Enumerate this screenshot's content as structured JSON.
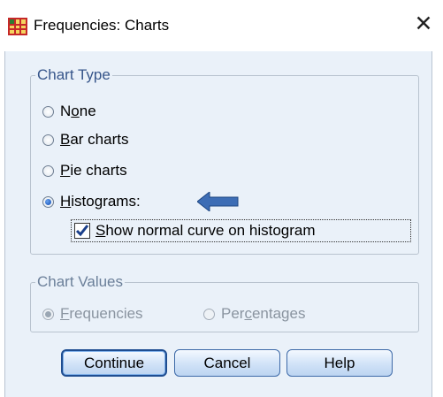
{
  "window": {
    "title": "Frequencies: Charts",
    "close_glyph": "✕"
  },
  "chart_type": {
    "legend": "Chart Type",
    "options": [
      {
        "label": "None",
        "mnemonic_index": 1,
        "checked": false
      },
      {
        "label": "Bar charts",
        "mnemonic_index": 0,
        "checked": false
      },
      {
        "label": "Pie charts",
        "mnemonic_index": 0,
        "checked": false
      },
      {
        "label": "Histograms:",
        "mnemonic_index": 0,
        "checked": true
      }
    ],
    "show_normal_curve": {
      "label": "Show normal curve on histogram",
      "checked": true
    }
  },
  "chart_values": {
    "legend": "Chart Values",
    "options": [
      {
        "label": "Frequencies",
        "checked": true,
        "enabled": false
      },
      {
        "label": "Percentages",
        "checked": false,
        "enabled": false
      }
    ]
  },
  "buttons": {
    "continue": "Continue",
    "cancel": "Cancel",
    "help": "Help"
  },
  "colors": {
    "accent": "#2f5ea3",
    "client_bg": "#eaf1f9",
    "legend_text": "#36558a",
    "arrow": "#3d6db5"
  }
}
